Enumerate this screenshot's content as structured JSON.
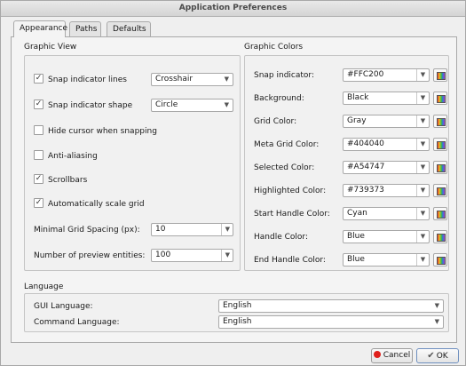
{
  "window": {
    "title": "Application Preferences"
  },
  "tabs": [
    {
      "label": "Appearance"
    },
    {
      "label": "Paths"
    },
    {
      "label": "Defaults"
    }
  ],
  "graphic_view": {
    "title": "Graphic View",
    "snap_indicator_lines": {
      "label": "Snap indicator lines",
      "checked": true,
      "value": "Crosshair"
    },
    "snap_indicator_shape": {
      "label": "Snap indicator shape",
      "checked": true,
      "value": "Circle"
    },
    "hide_cursor": {
      "label": "Hide cursor when snapping",
      "checked": false
    },
    "anti_aliasing": {
      "label": "Anti-aliasing",
      "checked": false
    },
    "scrollbars": {
      "label": "Scrollbars",
      "checked": true
    },
    "auto_scale_grid": {
      "label": "Automatically scale grid",
      "checked": true
    },
    "min_grid_spacing": {
      "label": "Minimal Grid Spacing (px):",
      "value": "10"
    },
    "preview_entities": {
      "label": "Number of preview entities:",
      "value": "100"
    }
  },
  "graphic_colors": {
    "title": "Graphic Colors",
    "rows": [
      {
        "label": "Snap indicator:",
        "value": "#FFC200"
      },
      {
        "label": "Background:",
        "value": "Black"
      },
      {
        "label": "Grid Color:",
        "value": "Gray"
      },
      {
        "label": "Meta Grid Color:",
        "value": "#404040"
      },
      {
        "label": "Selected Color:",
        "value": "#A54747"
      },
      {
        "label": "Highlighted Color:",
        "value": "#739373"
      },
      {
        "label": "Start Handle Color:",
        "value": "Cyan"
      },
      {
        "label": "Handle Color:",
        "value": "Blue"
      },
      {
        "label": "End Handle Color:",
        "value": "Blue"
      }
    ]
  },
  "language": {
    "title": "Language",
    "gui": {
      "label": "GUI Language:",
      "value": "English"
    },
    "command": {
      "label": "Command Language:",
      "value": "English"
    }
  },
  "buttons": {
    "cancel": "Cancel",
    "ok": "OK"
  },
  "icons": {
    "color_picker": "color-palette-icon",
    "cancel": "red-circle-icon",
    "ok": "checkmark-icon"
  }
}
